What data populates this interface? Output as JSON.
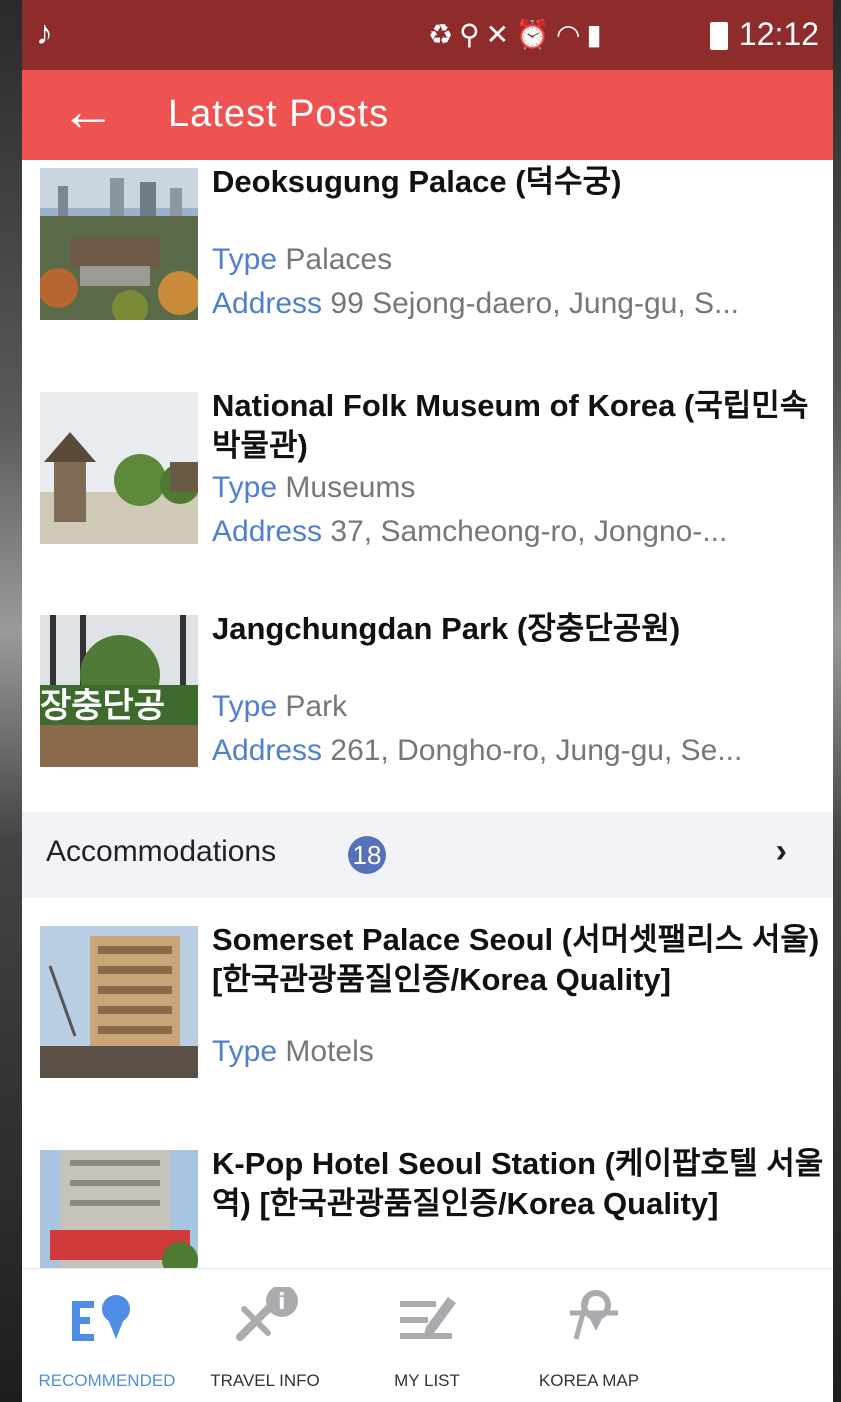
{
  "status_bar": {
    "time": "12:12"
  },
  "app_bar": {
    "back_label": "←",
    "title": "Latest Posts"
  },
  "labels": {
    "type": "Type",
    "address": "Address"
  },
  "posts": [
    {
      "name": "Deoksugung Palace (덕수궁)",
      "type": "Palaces",
      "address": "99 Sejong-daero, Jung-gu, S..."
    },
    {
      "name": "National Folk Museum of Korea (국립민속박물관)",
      "type": "Museums",
      "address": "37, Samcheong-ro, Jongno-..."
    },
    {
      "name": "Jangchungdan Park (장충단공원)",
      "type": "Park",
      "address": "261, Dongho-ro, Jung-gu, Se..."
    }
  ],
  "section": {
    "title": "Accommodations",
    "count": "18",
    "chevron": "›"
  },
  "accommodations": [
    {
      "name": "Somerset Palace Seoul (서머셋팰리스 서울)[한국관광품질인증/Korea Quality]",
      "type": "Motels"
    },
    {
      "name": "K-Pop Hotel Seoul Station (케이팝호텔 서울역) [한국관광품질인증/Korea Quality]"
    }
  ],
  "nav": [
    {
      "label": "RECOMMENDED",
      "icon": "recommended-icon",
      "active": true
    },
    {
      "label": "TRAVEL INFO",
      "icon": "travel-info-icon",
      "active": false
    },
    {
      "label": "MY LIST",
      "icon": "my-list-icon",
      "active": false
    },
    {
      "label": "KOREA MAP",
      "icon": "korea-map-icon",
      "active": false
    }
  ],
  "colors": {
    "status_bar": "#8e2b2b",
    "app_bar": "#ef5351",
    "label_blue": "#4f7fd0",
    "badge": "#5571b9",
    "nav_active": "#4e8de5"
  }
}
